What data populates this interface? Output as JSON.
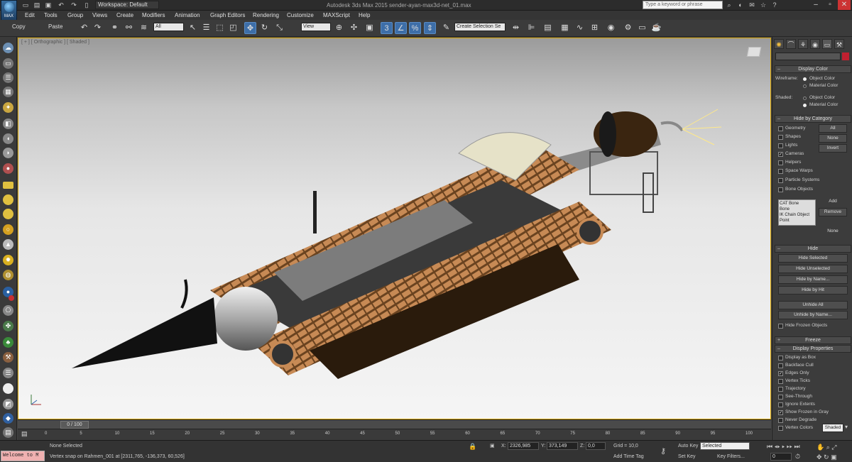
{
  "titlebar": {
    "app_badge": "MAX",
    "workspace": "Workspace: Default",
    "window_title": "Autodesk 3ds Max 2015    sender-ayan-max3d-net_01.max",
    "search_placeholder": "Type a keyword or phrase"
  },
  "menus": [
    "Edit",
    "Tools",
    "Group",
    "Views",
    "Create",
    "Modifiers",
    "Animation",
    "Graph Editors",
    "Rendering",
    "Customize",
    "MAXScript",
    "Help"
  ],
  "toolbar": {
    "copy_label": "Copy",
    "paste_label": "Paste",
    "selection_filter": "All",
    "ref_coord": "View",
    "named_selection": "Create Selection Se"
  },
  "viewport": {
    "label": "[ + ] [ Orthographic ] [ Shaded ]"
  },
  "timeline": {
    "slider_label": "0 / 100",
    "ticks": [
      "0",
      "5",
      "10",
      "15",
      "20",
      "25",
      "30",
      "35",
      "40",
      "45",
      "50",
      "55",
      "60",
      "65",
      "70",
      "75",
      "80",
      "85",
      "90",
      "95",
      "100"
    ]
  },
  "status": {
    "selection": "None Selected",
    "prompt": "Vertex snap on Rahmen_001 at [2311,765, -136,373, 60,526]",
    "maxscript": "Welcome to M",
    "x_value": "2326,985",
    "y_value": "373,149",
    "z_value": "0,0",
    "grid": "Grid = 10,0",
    "add_time_tag": "Add Time Tag",
    "auto_key": "Auto Key",
    "key_mode": "Selected",
    "set_key": "Set Key",
    "key_filters": "Key Filters...",
    "frame": "0",
    "x_label": "X:",
    "y_label": "Y:",
    "z_label": "Z:"
  },
  "panel": {
    "display_color": {
      "title": "Display Color",
      "wireframe": "Wireframe:",
      "shaded": "Shaded:",
      "object_color": "Object Color",
      "material_color": "Material Color"
    },
    "hide_by_category": {
      "title": "Hide by Category",
      "items": [
        "Geometry",
        "Shapes",
        "Lights",
        "Cameras",
        "Helpers",
        "Space Warps",
        "Particle Systems",
        "Bone Objects"
      ],
      "checked": [
        false,
        false,
        false,
        true,
        false,
        false,
        false,
        false
      ],
      "all": "All",
      "none": "None",
      "invert": "Invert",
      "list": [
        "CAT Bone",
        "Bone",
        "IK Chain Object",
        "Point"
      ],
      "add": "Add",
      "remove": "Remove",
      "none2": "None"
    },
    "hide": {
      "title": "Hide",
      "buttons": [
        "Hide Selected",
        "Hide Unselected",
        "Hide by Name...",
        "Hide by Hit",
        "Unhide All",
        "Unhide by Name..."
      ],
      "hide_frozen": "Hide Frozen Objects"
    },
    "freeze_title": "Freeze",
    "display_properties": {
      "title": "Display Properties",
      "items": [
        "Display as Box",
        "Backface Cull",
        "Edges Only",
        "Vertex Ticks",
        "Trajectory",
        "See-Through",
        "Ignore Extents",
        "Show Frozen in Gray",
        "Never Degrade",
        "Vertex Colors"
      ],
      "checked": [
        false,
        false,
        true,
        false,
        false,
        false,
        false,
        true,
        false,
        false
      ],
      "shaded_btn": "Shaded"
    }
  }
}
